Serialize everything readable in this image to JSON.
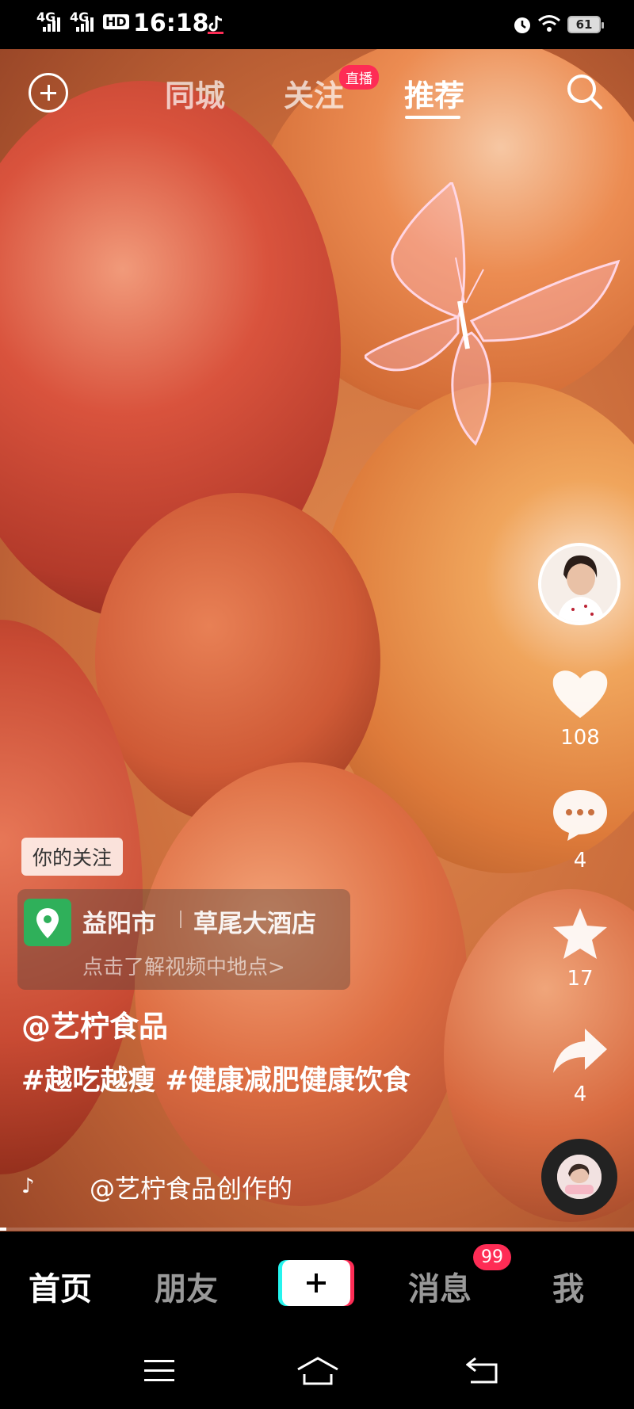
{
  "status_bar": {
    "network1": "4G",
    "network2": "4G",
    "hd": "HD",
    "time": "16:18",
    "battery": "61"
  },
  "top_nav": {
    "tabs": [
      "同城",
      "关注",
      "推荐"
    ],
    "active_tab": "推荐",
    "live_badge": "直播"
  },
  "right_rail": {
    "likes": "108",
    "comments": "4",
    "favorites": "17",
    "shares": "4"
  },
  "video_info": {
    "follow_tag": "你的关注",
    "location_city": "益阳市",
    "location_name": "草尾大酒店",
    "location_hint": "点击了解视频中地点>",
    "author": "@艺柠食品",
    "description": "#越吃越瘦 #健康减肥健康饮食",
    "music": "@艺柠食品创作的",
    "progress_fraction": 0.01
  },
  "bottom_nav": {
    "home": "首页",
    "friends": "朋友",
    "messages": "消息",
    "messages_badge": "99",
    "me": "我"
  },
  "colors": {
    "accent_red": "#fe2c55",
    "accent_cyan": "#25f4ee",
    "location_green": "#2fb05a"
  }
}
